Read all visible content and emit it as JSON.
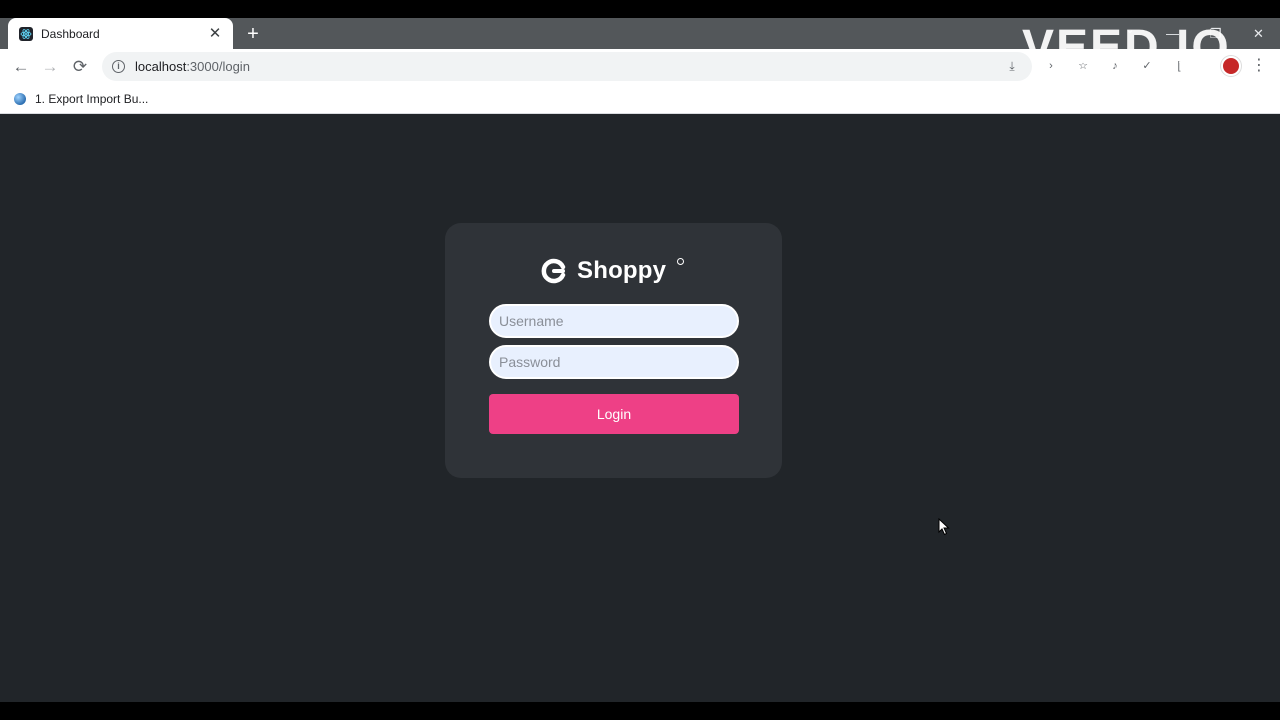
{
  "browser": {
    "tab": {
      "title": "Dashboard",
      "favicon": "react-icon"
    },
    "window_controls": [
      "minimize-icon",
      "restore-icon",
      "close-icon"
    ],
    "toolbar": {
      "back": "←",
      "forward": "→",
      "reload": "⟳",
      "url_host": "localhost",
      "url_path": ":3000/login",
      "extensions": [
        "extension-icon",
        "star-icon",
        "extension-icon",
        "extension-icon",
        "extension-icon"
      ],
      "menu": "⋮"
    },
    "bookmarks": [
      {
        "label": "1. Export Import Bu..."
      }
    ]
  },
  "watermark": {
    "text": "VEED.IO"
  },
  "login": {
    "brand_name": "Shoppy",
    "username_placeholder": "Username",
    "password_placeholder": "Password",
    "submit_label": "Login"
  },
  "colors": {
    "page_background": "#212529",
    "card_background": "#2f3338",
    "accent": "#ee4086",
    "input_background": "#e8f0fe"
  }
}
